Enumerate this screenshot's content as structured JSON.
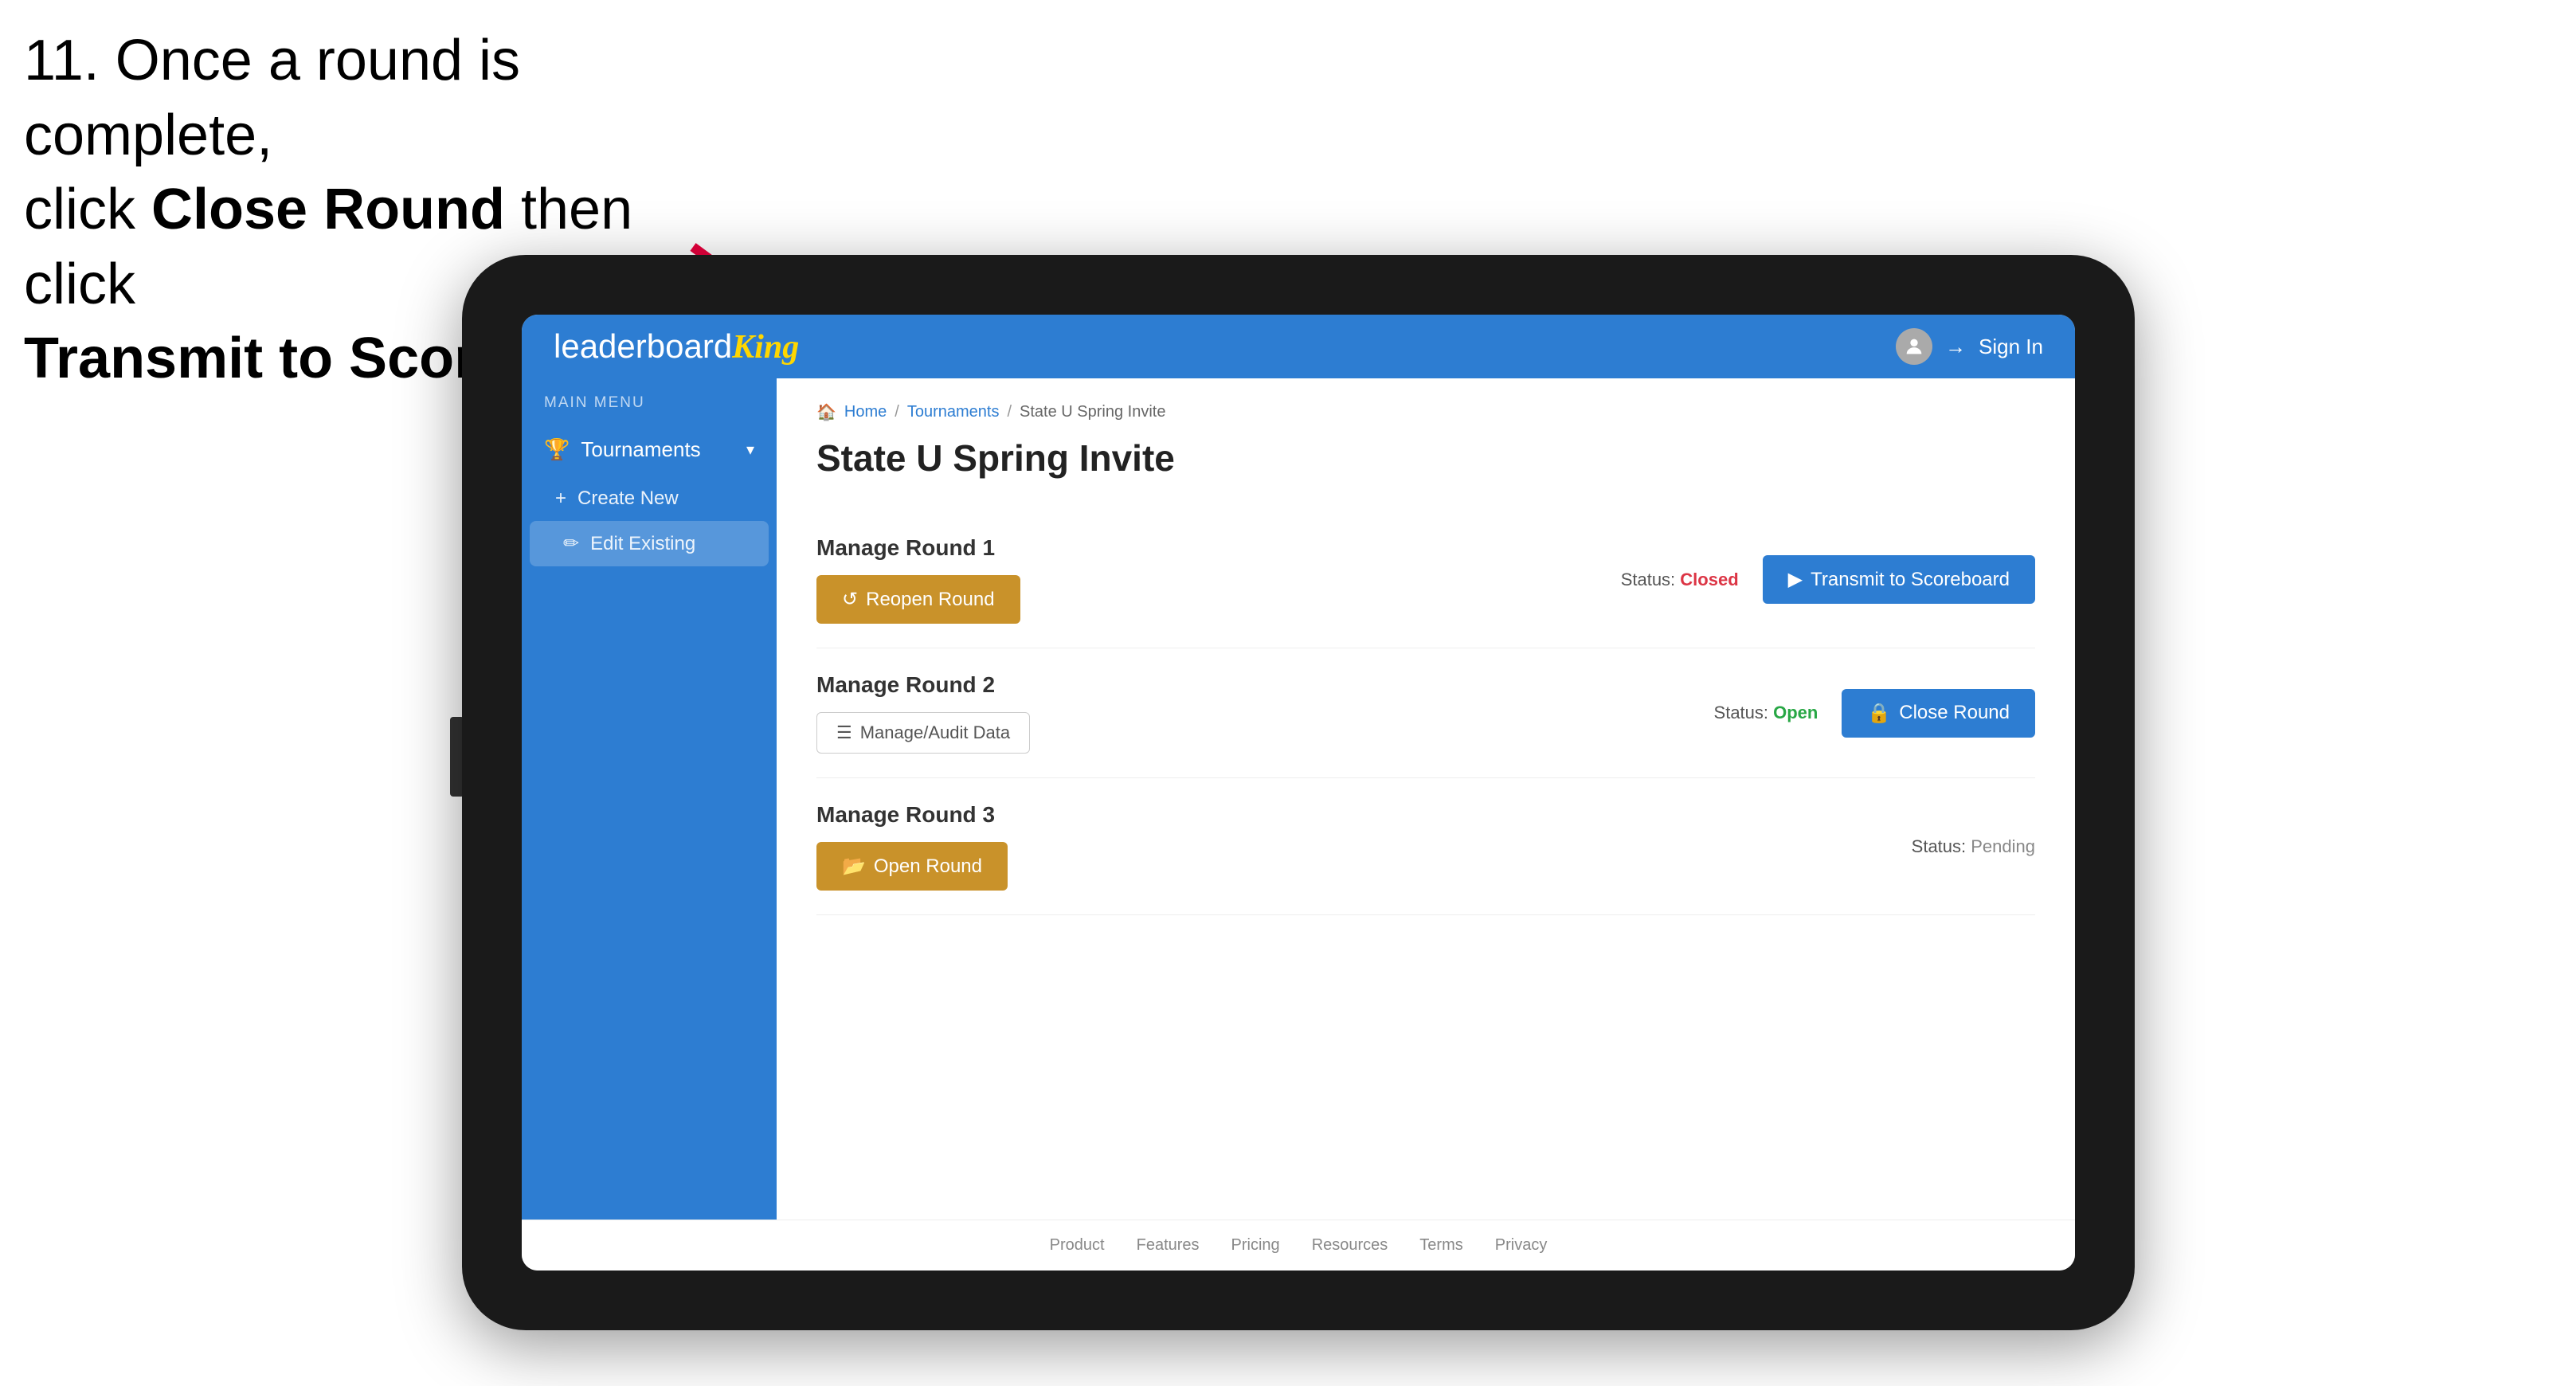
{
  "instruction": {
    "line1": "11. Once a round is complete,",
    "line2": "click ",
    "bold1": "Close Round",
    "line3": " then click",
    "bold2": "Transmit to Scoreboard."
  },
  "top_bar": {
    "logo_plain": "leaderboard",
    "logo_bold": "King",
    "sign_in": "Sign In"
  },
  "sidebar": {
    "main_menu_label": "MAIN MENU",
    "tournaments_label": "Tournaments",
    "create_new_label": "Create New",
    "edit_existing_label": "Edit Existing"
  },
  "breadcrumb": {
    "home": "Home",
    "sep1": "/",
    "tournaments": "Tournaments",
    "sep2": "/",
    "current": "State U Spring Invite"
  },
  "page_title": "State U Spring Invite",
  "rounds": [
    {
      "id": "round1",
      "title": "Manage Round 1",
      "status_label": "Status:",
      "status_value": "Closed",
      "status_class": "status-closed",
      "button1_label": "Reopen Round",
      "button1_type": "gold",
      "button2_label": "Transmit to Scoreboard",
      "button2_type": "blue"
    },
    {
      "id": "round2",
      "title": "Manage Round 2",
      "status_label": "Status:",
      "status_value": "Open",
      "status_class": "status-open",
      "button1_label": "Manage/Audit Data",
      "button1_type": "audit",
      "button2_label": "Close Round",
      "button2_type": "blue"
    },
    {
      "id": "round3",
      "title": "Manage Round 3",
      "status_label": "Status:",
      "status_value": "Pending",
      "status_class": "status-pending",
      "button1_label": "Open Round",
      "button1_type": "gold",
      "button2_label": null,
      "button2_type": null
    }
  ],
  "footer": {
    "links": [
      "Product",
      "Features",
      "Pricing",
      "Resources",
      "Terms",
      "Privacy"
    ]
  },
  "icons": {
    "trophy": "🏆",
    "plus": "+",
    "edit": "✏",
    "reopen": "↺",
    "transmit": "▶",
    "close": "🔒",
    "open": "📂",
    "audit": "☰",
    "chevron": "▾",
    "user": "👤",
    "signin_arrow": "→",
    "home_icon": "🏠"
  }
}
